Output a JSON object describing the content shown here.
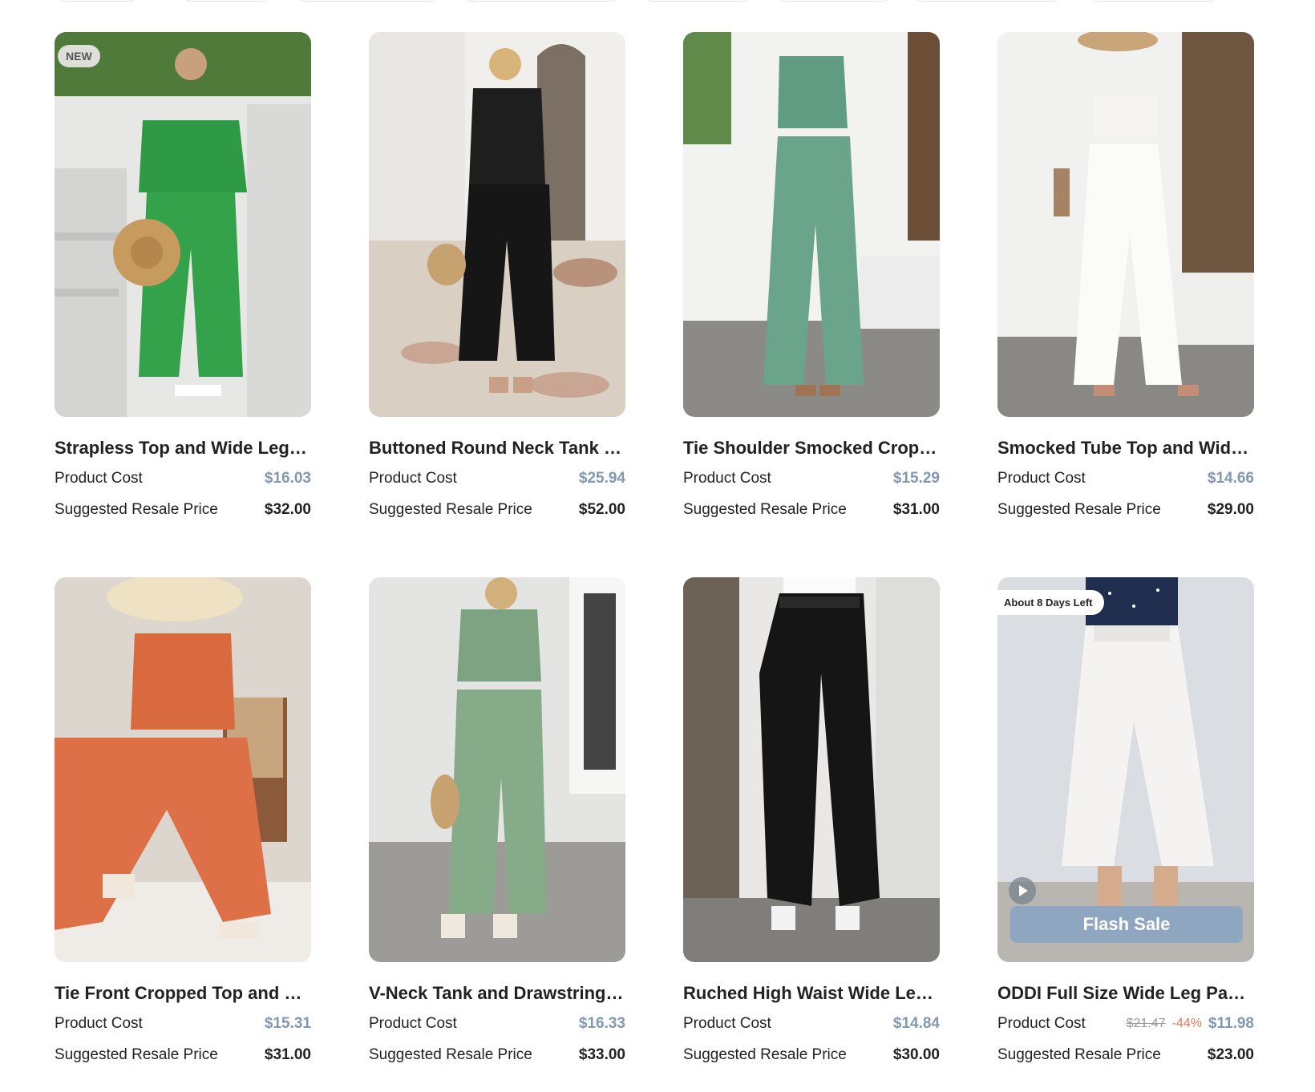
{
  "labels": {
    "product_cost": "Product Cost",
    "suggested_resale": "Suggested Resale Price",
    "flash_sale": "Flash Sale"
  },
  "colors": {
    "cost_price": "#8198b1",
    "discount": "#e07a57",
    "flash_bar": "#8fa6c0"
  },
  "products": [
    {
      "title": "Strapless Top and Wide Leg Pants Set",
      "badge": "NEW",
      "cost": "$16.03",
      "resale": "$32.00"
    },
    {
      "title": "Buttoned Round Neck Tank Top and Pants Set",
      "cost": "$25.94",
      "resale": "$52.00"
    },
    {
      "title": "Tie Shoulder Smocked Cropped Top and Pants Set",
      "cost": "$15.29",
      "resale": "$31.00"
    },
    {
      "title": "Smocked Tube Top and Wide Leg Pants Set",
      "cost": "$14.66",
      "resale": "$29.00"
    },
    {
      "title": "Tie Front Cropped Top and Wide Leg Pants Set",
      "cost": "$15.31",
      "resale": "$31.00"
    },
    {
      "title": "V-Neck Tank and Drawstring Pants Set",
      "cost": "$16.33",
      "resale": "$33.00"
    },
    {
      "title": "Ruched High Waist Wide Leg Pants",
      "cost": "$14.84",
      "resale": "$30.00"
    },
    {
      "title": "ODDI Full Size Wide Leg Pants",
      "badge_days": "About 8 Days Left",
      "original_cost": "$21.47",
      "discount": "-44%",
      "cost": "$11.98",
      "resale": "$23.00"
    }
  ]
}
